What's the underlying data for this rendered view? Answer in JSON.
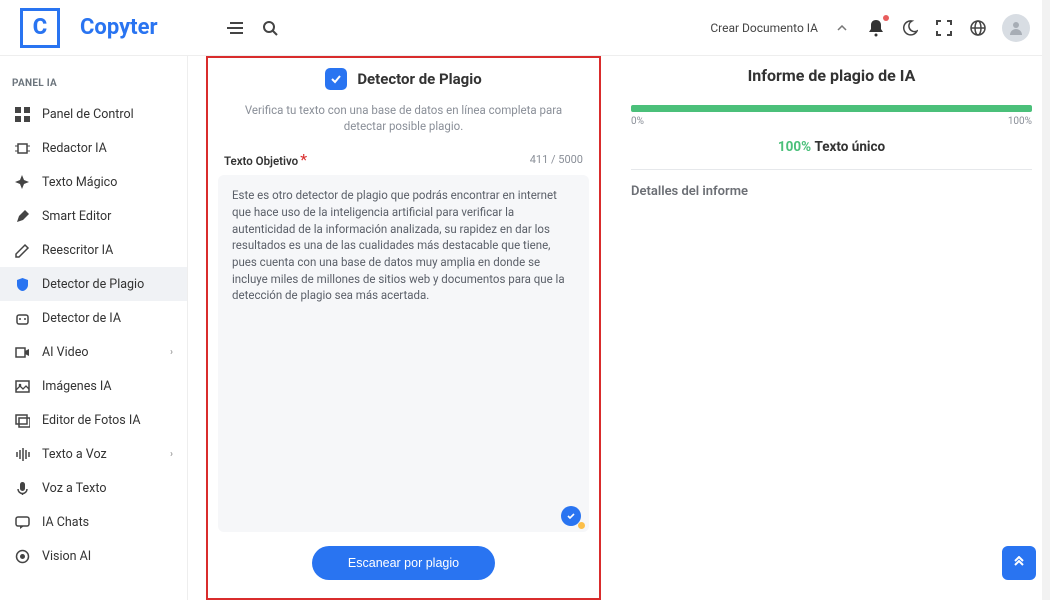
{
  "brand": "Copyter",
  "logo_letter": "C",
  "topbar": {
    "create_doc": "Crear Documento IA"
  },
  "sidebar": {
    "section": "PANEL IA",
    "items": [
      {
        "label": "Panel de Control"
      },
      {
        "label": "Redactor IA"
      },
      {
        "label": "Texto Mágico"
      },
      {
        "label": "Smart Editor"
      },
      {
        "label": "Reescritor IA"
      },
      {
        "label": "Detector de Plagio"
      },
      {
        "label": "Detector de IA"
      },
      {
        "label": "AI Video"
      },
      {
        "label": "Imágenes IA"
      },
      {
        "label": "Editor de Fotos IA"
      },
      {
        "label": "Texto a Voz"
      },
      {
        "label": "Voz a Texto"
      },
      {
        "label": "IA Chats"
      },
      {
        "label": "Vision AI"
      }
    ]
  },
  "detector": {
    "title": "Detector de Plagio",
    "subtitle": "Verifica tu texto con una base de datos en línea completa para detectar posible plagio.",
    "field_label": "Texto Objetivo",
    "counter": "411 / 5000",
    "text": "Este es otro detector de plagio que podrás encontrar en internet que hace uso de la inteligencia artificial para verificar la autenticidad de la información analizada, su rapidez en dar los resultados es una de las cualidades más destacable que tiene, pues cuenta con una base de datos muy amplia en donde se incluye miles de millones de sitios web y documentos para que la detección de plagio sea más acertada.",
    "scan_button": "Escanear por plagio"
  },
  "report": {
    "title": "Informe de plagio de IA",
    "label_min": "0%",
    "label_max": "100%",
    "percent": "100%",
    "result_text": "Texto único",
    "details_label": "Detalles del informe"
  }
}
